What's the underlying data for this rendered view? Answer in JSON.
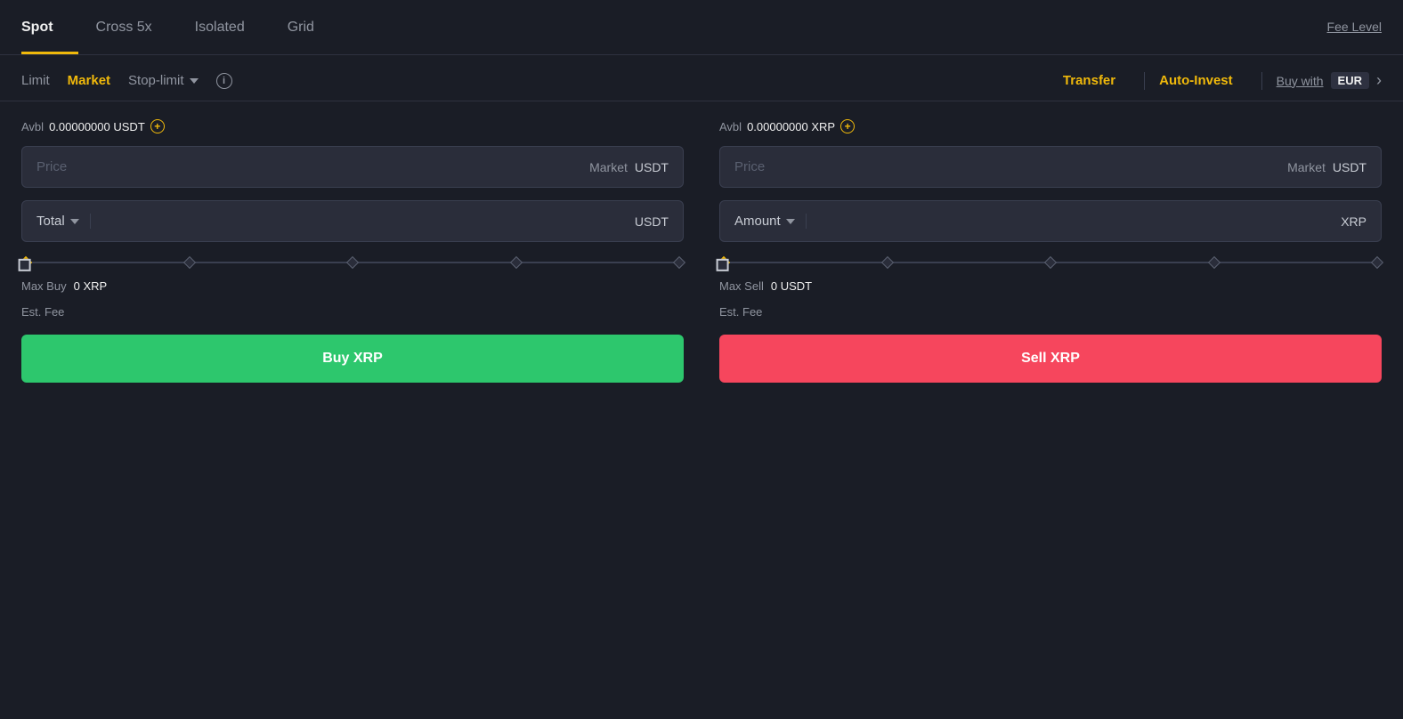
{
  "tabs": {
    "spot": {
      "label": "Spot",
      "active": true
    },
    "cross5x": {
      "label": "Cross 5x"
    },
    "isolated": {
      "label": "Isolated"
    },
    "grid": {
      "label": "Grid"
    },
    "fee_level": {
      "label": "Fee Level"
    }
  },
  "order_types": {
    "limit": {
      "label": "Limit"
    },
    "market": {
      "label": "Market",
      "active": true
    },
    "stop_limit": {
      "label": "Stop-limit"
    }
  },
  "actions": {
    "transfer": "Transfer",
    "auto_invest": "Auto-Invest",
    "buy_with_label": "Buy with",
    "buy_with_currency": "EUR"
  },
  "buy_side": {
    "avbl_label": "Avbl",
    "avbl_value": "0.00000000",
    "avbl_currency": "USDT",
    "price_placeholder": "Price",
    "price_market": "Market",
    "price_currency": "USDT",
    "total_label": "Total",
    "total_currency": "USDT",
    "max_label": "Max Buy",
    "max_value": "0",
    "max_currency": "XRP",
    "est_fee_label": "Est. Fee",
    "button_label": "Buy XRP"
  },
  "sell_side": {
    "avbl_label": "Avbl",
    "avbl_value": "0.00000000",
    "avbl_currency": "XRP",
    "price_placeholder": "Price",
    "price_market": "Market",
    "price_currency": "USDT",
    "amount_label": "Amount",
    "amount_currency": "XRP",
    "max_label": "Max Sell",
    "max_value": "0",
    "max_currency": "USDT",
    "est_fee_label": "Est. Fee",
    "button_label": "Sell XRP"
  },
  "colors": {
    "active_tab_border": "#f0b90b",
    "buy_green": "#2dc76d",
    "sell_red": "#f6465d",
    "yellow": "#f0b90b"
  }
}
